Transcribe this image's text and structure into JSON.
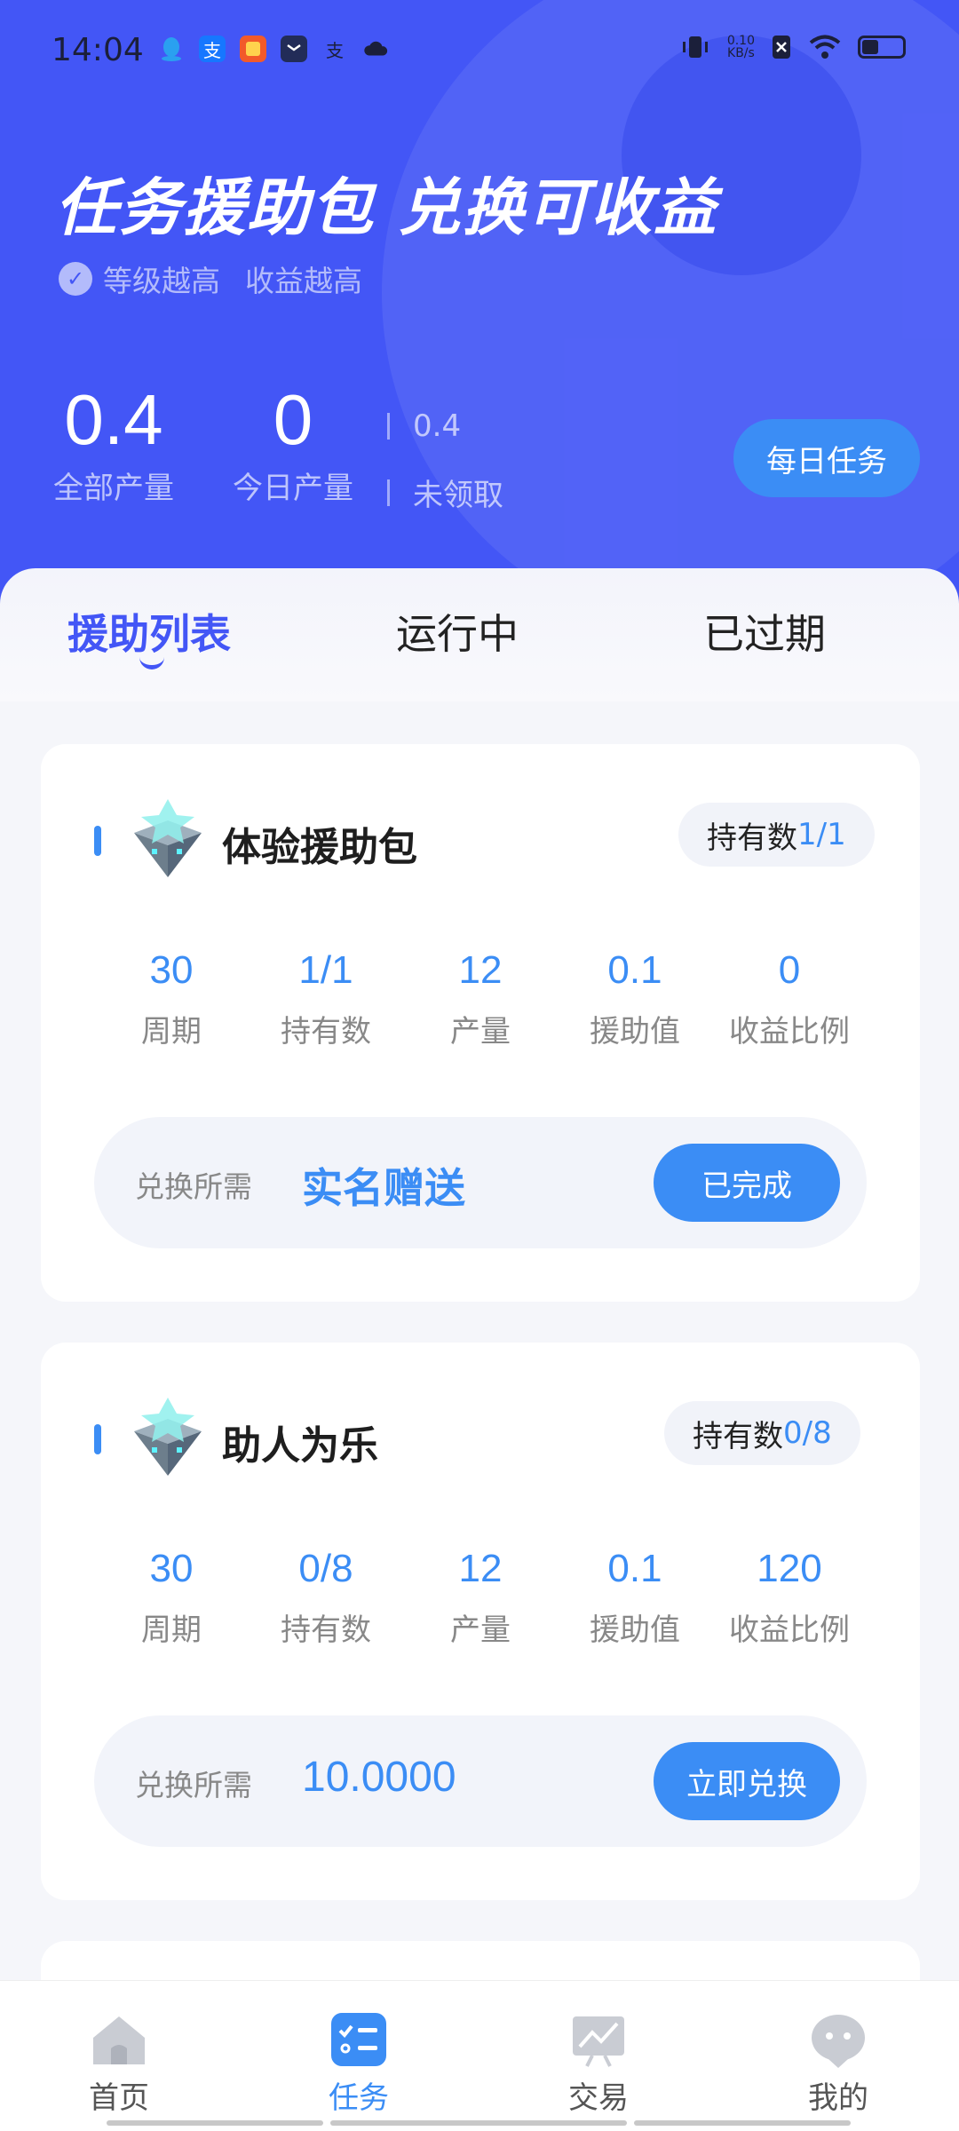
{
  "status_bar": {
    "time": "14:04",
    "net_speed_value": "0.10",
    "net_speed_unit": "KB/s",
    "notification_icons": [
      "qq-icon",
      "alipay-icon",
      "app-icon",
      "message-icon",
      "alipay-icon",
      "cloud-icon"
    ],
    "right_icons": [
      "vibrate-icon",
      "net-speed-icon",
      "sim-icon",
      "wifi-icon",
      "battery-icon"
    ]
  },
  "hero": {
    "title": "任务援助包 兑换可收益",
    "subtitle_1": "等级越高",
    "subtitle_2": "收益越高",
    "stat_total_value": "0.4",
    "stat_total_label": "全部产量",
    "stat_today_value": "0",
    "stat_today_label": "今日产量",
    "unclaimed_value": "0.4",
    "unclaimed_label": "未领取",
    "daily_button": "每日任务",
    "colors": {
      "background": "#4356f6",
      "button": "#3b8df5"
    }
  },
  "tabs": [
    {
      "label": "援助列表",
      "active": true
    },
    {
      "label": "运行中",
      "active": false
    },
    {
      "label": "已过期",
      "active": false
    }
  ],
  "cards": [
    {
      "title": "体验援助包",
      "hold_label": "持有数",
      "hold_value": "1/1",
      "metrics": [
        {
          "value": "30",
          "label": "周期"
        },
        {
          "value": "1/1",
          "label": "持有数"
        },
        {
          "value": "12",
          "label": "产量"
        },
        {
          "value": "0.1",
          "label": "援助值"
        },
        {
          "value": "0",
          "label": "收益比例"
        }
      ],
      "exchange_label": "兑换所需",
      "exchange_value": "实名赠送",
      "button": "已完成"
    },
    {
      "title": "助人为乐",
      "hold_label": "持有数",
      "hold_value": "0/8",
      "metrics": [
        {
          "value": "30",
          "label": "周期"
        },
        {
          "value": "0/8",
          "label": "持有数"
        },
        {
          "value": "12",
          "label": "产量"
        },
        {
          "value": "0.1",
          "label": "援助值"
        },
        {
          "value": "120",
          "label": "收益比例"
        }
      ],
      "exchange_label": "兑换所需",
      "exchange_value": "10.0000",
      "button": "立即兑换"
    }
  ],
  "bottom_nav": [
    {
      "label": "首页",
      "icon": "home-icon",
      "active": false
    },
    {
      "label": "任务",
      "icon": "task-list-icon",
      "active": true
    },
    {
      "label": "交易",
      "icon": "trade-chart-icon",
      "active": false
    },
    {
      "label": "我的",
      "icon": "profile-icon",
      "active": false
    }
  ],
  "accent_color": "#3b8df5"
}
